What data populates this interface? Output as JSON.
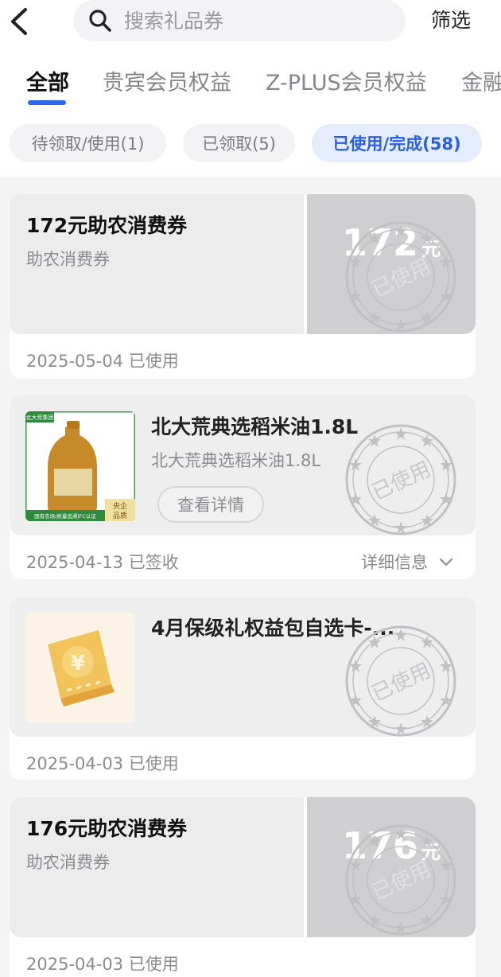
{
  "header": {
    "search_placeholder": "搜索礼品券",
    "filter_label": "筛选"
  },
  "tabs": [
    {
      "label": "全部",
      "active": true
    },
    {
      "label": "贵宾会员权益",
      "active": false
    },
    {
      "label": "Z-PLUS会员权益",
      "active": false
    },
    {
      "label": "金融",
      "active": false
    }
  ],
  "status_filters": [
    {
      "label": "待领取/使用(1)",
      "active": false
    },
    {
      "label": "已领取(5)",
      "active": false
    },
    {
      "label": "已使用/完成(58)",
      "active": true
    }
  ],
  "stamp_text": "已使用",
  "cards": [
    {
      "type": "coupon",
      "title": "172元助农消费券",
      "subtitle": "助农消费券",
      "amount": "172",
      "unit": "元",
      "footer": "2025-05-04 已使用"
    },
    {
      "type": "product",
      "title": "北大荒典选稻米油1.8L",
      "subtitle": "北大荒典选稻米油1.8L",
      "button": "查看详情",
      "footer": "2025-04-13 已签收",
      "detail_label": "详细信息",
      "image_texts": {
        "brand": "北大荒集团",
        "badge": "央企品质",
        "strip": "国有农场|质量追溯|FC认证"
      }
    },
    {
      "type": "package",
      "title": "4月保级礼权益包自选卡-...",
      "footer": "2025-04-03 已使用",
      "icon": "yen-ticket-icon"
    },
    {
      "type": "coupon",
      "title": "176元助农消费券",
      "subtitle": "助农消费券",
      "amount": "176",
      "unit": "元",
      "footer": "2025-04-03 已使用"
    }
  ],
  "colors": {
    "accent": "#2a6ae8",
    "stamp": "#b9b9bd",
    "coupon_right": "#cfcfd1"
  }
}
